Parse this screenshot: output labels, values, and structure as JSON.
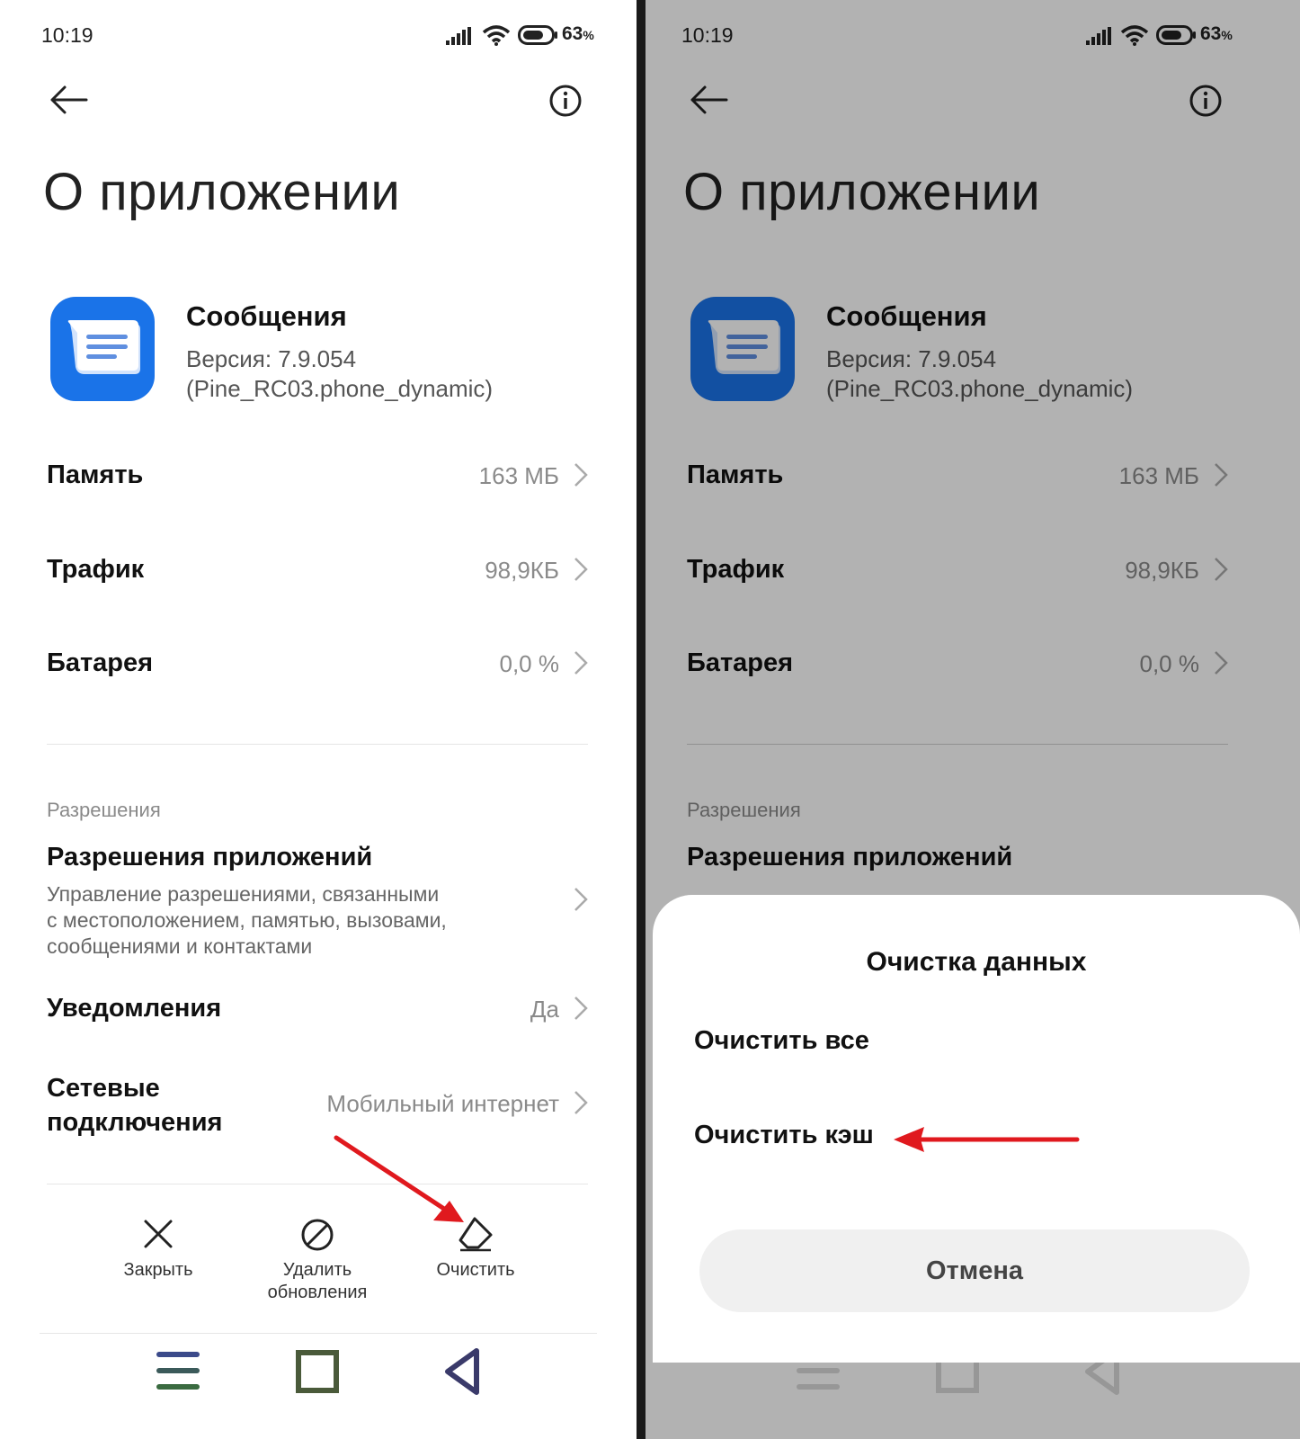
{
  "status": {
    "time": "10:19",
    "battery": "63"
  },
  "page": {
    "title": "О приложении"
  },
  "app": {
    "name": "Сообщения",
    "version_line1": "Версия: 7.9.054",
    "version_line2": "(Pine_RC03.phone_dynamic)"
  },
  "rows": [
    {
      "label": "Память",
      "value": "163 МБ"
    },
    {
      "label": "Трафик",
      "value": "98,9КБ"
    },
    {
      "label": "Батарея",
      "value": "0,0 %"
    }
  ],
  "permissions": {
    "section": "Разрешения",
    "title": "Разрешения приложений",
    "desc_line1": "Управление разрешениями, связанными",
    "desc_line2": "с местоположением, памятью, вызовами,",
    "desc_line3": "сообщениями и контактами"
  },
  "notifications": {
    "label": "Уведомления",
    "value": "Да"
  },
  "network": {
    "label_line1": "Сетевые",
    "label_line2": "подключения",
    "value": "Мобильный интернет"
  },
  "actions": {
    "close": "Закрыть",
    "uninstall_line1": "Удалить",
    "uninstall_line2": "обновления",
    "clear": "Очистить"
  },
  "dialog": {
    "title": "Очистка данных",
    "clear_all": "Очистить все",
    "clear_cache": "Очистить кэш",
    "cancel": "Отмена"
  },
  "colors": {
    "app_icon": "#1a73e8",
    "annotation_arrow": "#e0191e"
  }
}
